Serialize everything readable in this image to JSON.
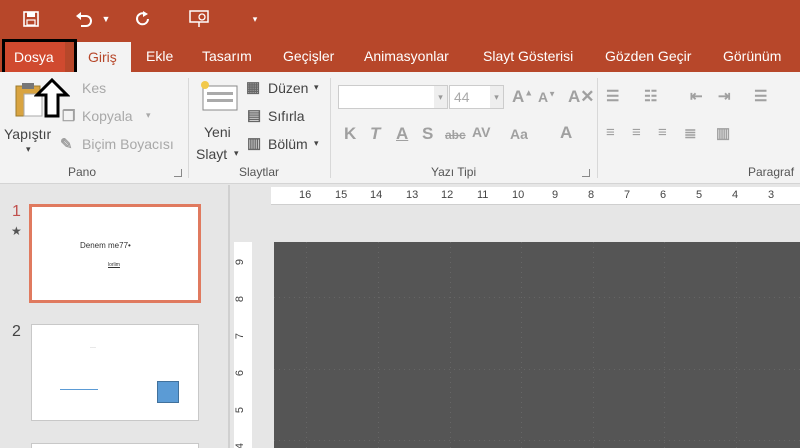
{
  "qat": {
    "save_icon": "save-icon",
    "undo_icon": "undo-icon",
    "redo_icon": "repeat-icon",
    "present_icon": "present-icon",
    "customize_icon": "customize-icon"
  },
  "tabs": {
    "file": "Dosya",
    "home": "Giriş",
    "insert": "Ekle",
    "design": "Tasarım",
    "transitions": "Geçişler",
    "animations": "Animasyonlar",
    "slideshow": "Slayt Gösterisi",
    "review": "Gözden Geçir",
    "view": "Görünüm"
  },
  "ribbon": {
    "clipboard": {
      "paste": "Yapıştır",
      "cut": "Kes",
      "copy": "Kopyala",
      "format_painter": "Biçim Boyacısı",
      "label": "Pano"
    },
    "slides": {
      "new_slide_line1": "Yeni",
      "new_slide_line2": "Slayt",
      "layout": "Düzen",
      "reset": "Sıfırla",
      "section": "Bölüm",
      "label": "Slaytlar"
    },
    "font": {
      "font_name": "",
      "font_size": "44",
      "label": "Yazı Tipi"
    },
    "paragraph": {
      "label": "Paragraf"
    }
  },
  "slides": [
    {
      "number": "1",
      "title": "Denem me77•",
      "subtitle": "lorlim"
    },
    {
      "number": "2",
      "title": "···"
    }
  ],
  "ruler": {
    "h_ticks": [
      "16",
      "15",
      "14",
      "13",
      "12",
      "11",
      "10",
      "9",
      "8",
      "7",
      "6",
      "5",
      "4",
      "3"
    ],
    "v_ticks": [
      "9",
      "8",
      "7",
      "6",
      "5",
      "4"
    ]
  },
  "colors": {
    "accent": "#b7472a",
    "file_tab": "#d04a2f",
    "selected_slide_border": "#e07a5f"
  }
}
